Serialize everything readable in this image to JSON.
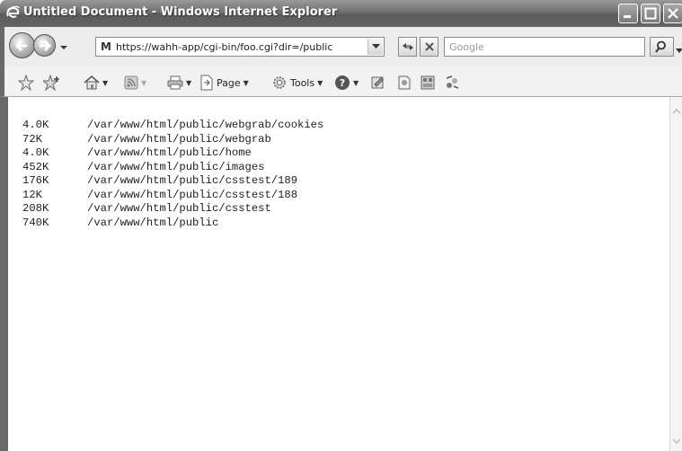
{
  "window": {
    "title": "Untitled Document - Windows Internet Explorer"
  },
  "address_bar": {
    "favicon": "M",
    "url": "https://wahh-app/cgi-bin/foo.cgi?dir=/public"
  },
  "search": {
    "placeholder": "Google"
  },
  "command_bar": {
    "page_label": "Page",
    "tools_label": "Tools"
  },
  "listing": [
    {
      "size": "4.0K",
      "path": "/var/www/html/public/webgrab/cookies"
    },
    {
      "size": "72K",
      "path": "/var/www/html/public/webgrab"
    },
    {
      "size": "4.0K",
      "path": "/var/www/html/public/home"
    },
    {
      "size": "452K",
      "path": "/var/www/html/public/images"
    },
    {
      "size": "176K",
      "path": "/var/www/html/public/csstest/189"
    },
    {
      "size": "12K",
      "path": "/var/www/html/public/csstest/188"
    },
    {
      "size": "208K",
      "path": "/var/www/html/public/csstest"
    },
    {
      "size": "740K",
      "path": "/var/www/html/public"
    }
  ]
}
